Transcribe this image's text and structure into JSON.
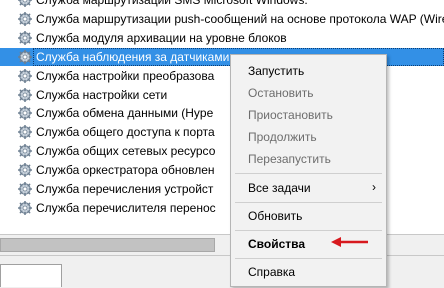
{
  "services": [
    {
      "name": "Служба маршрутизации SMS Microsoft Windows.",
      "selected": false
    },
    {
      "name": "Служба маршрутизации push-сообщений на основе протокола WAP (Wire",
      "selected": false
    },
    {
      "name": "Служба модуля архивации на уровне блоков",
      "selected": false
    },
    {
      "name": "Служба наблюдения за датчиками",
      "selected": true
    },
    {
      "name": "Служба настройки преобразова",
      "selected": false
    },
    {
      "name": "Служба настройки сети",
      "selected": false
    },
    {
      "name": "Служба обмена данными (Hype",
      "selected": false
    },
    {
      "name": "Служба общего доступа к порта",
      "selected": false
    },
    {
      "name": "Служба общих сетевых ресурсо",
      "selected": false
    },
    {
      "name": "Служба оркестратора обновлен",
      "selected": false
    },
    {
      "name": "Служба перечисления устройст",
      "selected": false
    },
    {
      "name": "Служба перечислителя перенос",
      "selected": false
    }
  ],
  "context_menu": {
    "start": "Запустить",
    "stop": "Остановить",
    "pause": "Приостановить",
    "resume": "Продолжить",
    "restart": "Перезапустить",
    "all_tasks": "Все задачи",
    "submenu_arrow": "›",
    "refresh": "Обновить",
    "properties": "Свойства",
    "help": "Справка"
  },
  "annotation_arrow_color": "#d7191e",
  "selection_color": "#3390e6"
}
